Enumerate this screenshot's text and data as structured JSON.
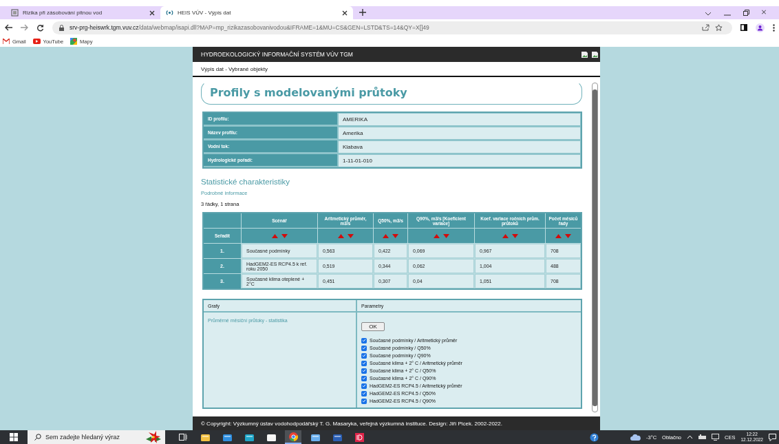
{
  "browser": {
    "tabs": [
      {
        "title": "Rizika při zásobování pitnou vod",
        "selected": false
      },
      {
        "title": "HEIS VÚV - Výpis dat",
        "selected": true
      }
    ],
    "url_host": "srv-prg-heiswrk.tgm.vuv.cz",
    "url_path": "/data/webmap/isapi.dll?MAP=mp_rizikazasobovanivodou&IFRAME=1&MU=CS&GEN=LSTD&TS=14&QY=X[]49",
    "bookmarks": [
      {
        "label": "Gmail",
        "kind": "mail"
      },
      {
        "label": "YouTube",
        "kind": "video"
      },
      {
        "label": "Mapy",
        "kind": "map"
      }
    ]
  },
  "page": {
    "system_title": "HYDROEKOLOGICKÝ INFORMAČNÍ SYSTÉM VÚV TGM",
    "breadcrumb": "Výpis dat - Vybrané objekty",
    "heading": "Profily s modelovanými průtoky",
    "profile": [
      {
        "label": "ID profilu:",
        "value": "AMERIKA"
      },
      {
        "label": "Název profilu:",
        "value": "Amerika"
      },
      {
        "label": "Vodní tok:",
        "value": "Klabava"
      },
      {
        "label": "Hydrologické pořadí:",
        "value": "1-11-01-010"
      }
    ],
    "stats_title": "Statistické charakteristiky",
    "details_link": "Podrobné informace",
    "row_count": "3 řádky, 1 strana",
    "table": {
      "sort_label": "Seřadit",
      "columns": [
        "Scénář",
        "Aritmetický průměr, m3/s",
        "Q50%, m3/s",
        "Q90%, m3/s [Koeficient variace]",
        "Koef. variace ročních prům. průtoků",
        "Počet měsíců řady"
      ],
      "rows": [
        {
          "number": "1.",
          "cells": [
            "Současné podmínky",
            "0,563",
            "0,422",
            "0,069",
            "0,967",
            "708"
          ]
        },
        {
          "number": "2.",
          "cells": [
            "HadGEM2-ES RCP4.5 k ref. roku 2050",
            "0,519",
            "0,344",
            "0,062",
            "1,004",
            "488"
          ]
        },
        {
          "number": "3.",
          "cells": [
            "Současné klima oteplené + 2°C",
            "0,451",
            "0,307",
            "0,04",
            "1,051",
            "708"
          ]
        }
      ]
    },
    "graphs": {
      "header": "Grafy",
      "link": "Průměrné měsíční průtoky - statistika"
    },
    "parameters": {
      "header": "Parametry",
      "button": "OK",
      "options": [
        {
          "label": "Současné podmínky / Aritmetický průměr",
          "checked": true
        },
        {
          "label": "Současné podmínky / Q50%",
          "checked": true
        },
        {
          "label": "Současné podmínky / Q90%",
          "checked": true
        },
        {
          "label": "Současné klima + 2° C / Aritmetický průměr",
          "checked": true
        },
        {
          "label": "Současné klima + 2° C / Q50%",
          "checked": true
        },
        {
          "label": "Současné klima + 2° C / Q90%",
          "checked": true
        },
        {
          "label": "HadGEM2-ES RCP4.5 / Aritmetický průměr",
          "checked": true
        },
        {
          "label": "HadGEM2-ES RCP4.5 / Q50%",
          "checked": true
        },
        {
          "label": "HadGEM2-ES RCP4.5 / Q90%",
          "checked": true
        }
      ]
    },
    "footer": "© Copyright: Výzkumný ústav vodohodpodářský T. G. Masaryka, veřejná výzkumná instituce. Design: Jiří Picek. 2002-2022."
  },
  "taskbar": {
    "search_placeholder": "Sem zadejte hledaný výraz",
    "apps": [
      {
        "kind": "taskview",
        "selected": false
      },
      {
        "kind": "folder",
        "selected": false
      },
      {
        "kind": "mail",
        "selected": false
      },
      {
        "kind": "edge",
        "selected": false
      },
      {
        "kind": "store",
        "selected": false
      },
      {
        "kind": "chrome",
        "selected": true
      },
      {
        "kind": "media",
        "selected": false
      },
      {
        "kind": "word",
        "selected": false
      },
      {
        "kind": "id",
        "selected": false
      }
    ],
    "temperature": "-3°C",
    "weather": "Oblačno",
    "language": "CES",
    "time": "12:22",
    "date": "12.12.2022"
  }
}
